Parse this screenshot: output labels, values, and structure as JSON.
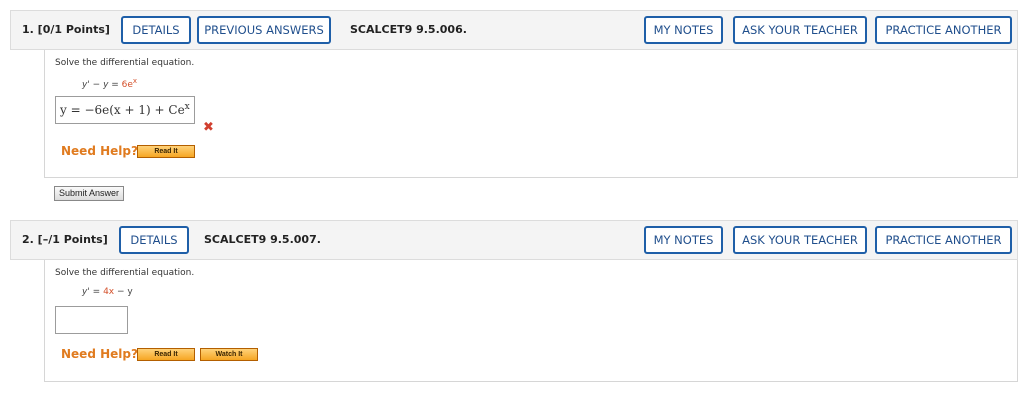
{
  "questions": [
    {
      "number_points": "1.  [0/1 Points]",
      "details_label": "DETAILS",
      "previous_answers_label": "PREVIOUS ANSWERS",
      "code": "SCALCET9 9.5.006.",
      "my_notes_label": "MY NOTES",
      "ask_teacher_label": "ASK YOUR TEACHER",
      "practice_another_label": "PRACTICE ANOTHER",
      "prompt": "Solve the differential equation.",
      "equation": {
        "lhs": "y' − y",
        "eq": " = ",
        "rhs": "6e",
        "sup": "x"
      },
      "answer": {
        "main": "y = −6e(x + 1) + Ce",
        "sup": "x"
      },
      "answer_status": "incorrect",
      "need_help": "Need Help?",
      "read_it": "Read It",
      "submit_label": "Submit Answer"
    },
    {
      "number_points": "2.  [–/1 Points]",
      "details_label": "DETAILS",
      "code": "SCALCET9 9.5.007.",
      "my_notes_label": "MY NOTES",
      "ask_teacher_label": "ASK YOUR TEACHER",
      "practice_another_label": "PRACTICE ANOTHER",
      "prompt": "Solve the differential equation.",
      "equation": {
        "lhs": "y'",
        "eq": " = ",
        "rhs": "4x",
        "rest": " − y"
      },
      "answer_value": "",
      "need_help": "Need Help?",
      "read_it": "Read It",
      "watch_it": "Watch It"
    }
  ],
  "colors": {
    "button_border": "#1f5fa8",
    "button_text": "#1f4e8c",
    "need_help": "#e07b1f",
    "incorrect": "#d13f2f"
  }
}
